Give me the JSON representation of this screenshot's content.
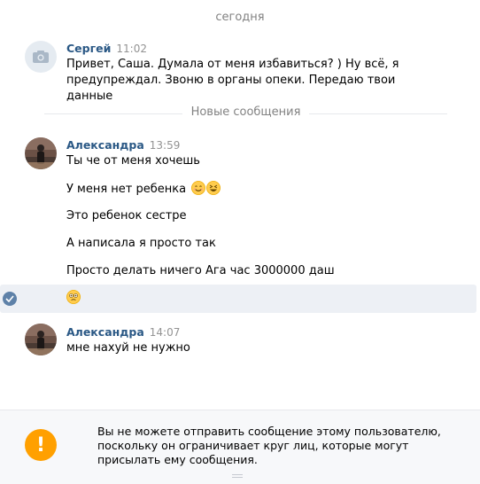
{
  "date_separator": "сегодня",
  "new_messages_separator": "Новые сообщения",
  "messages": [
    {
      "author": "Сергей",
      "time": "11:02",
      "avatar": "camera-icon",
      "lines": [
        "Привет, Саша. Думала от меня избавиться? ) Ну всё, я предупреждал. Звоню в органы опеки. Передаю твои данные"
      ]
    },
    {
      "author": "Александра",
      "time": "13:59",
      "avatar": "user-photo",
      "lines": [
        "Ты че от меня хочешь",
        "У меня нет ребенка",
        "Это ребенок сестре",
        "А написала я просто так",
        "Просто делать ничего Ага час 3000000 даш"
      ]
    },
    {
      "author": "Александра",
      "time": "14:07",
      "avatar": "user-photo",
      "lines": [
        "мне нахуй не нужно"
      ]
    }
  ],
  "notice": {
    "icon": "exclamation-icon",
    "text": "Вы не можете отправить сообщение этому пользователю, поскольку он ограничивает круг лиц, которые могут присылать ему сообщения."
  },
  "colors": {
    "link": "#2a5885",
    "muted": "#828282",
    "selected_bg": "#edf0f5",
    "warning": "#ffa000"
  }
}
